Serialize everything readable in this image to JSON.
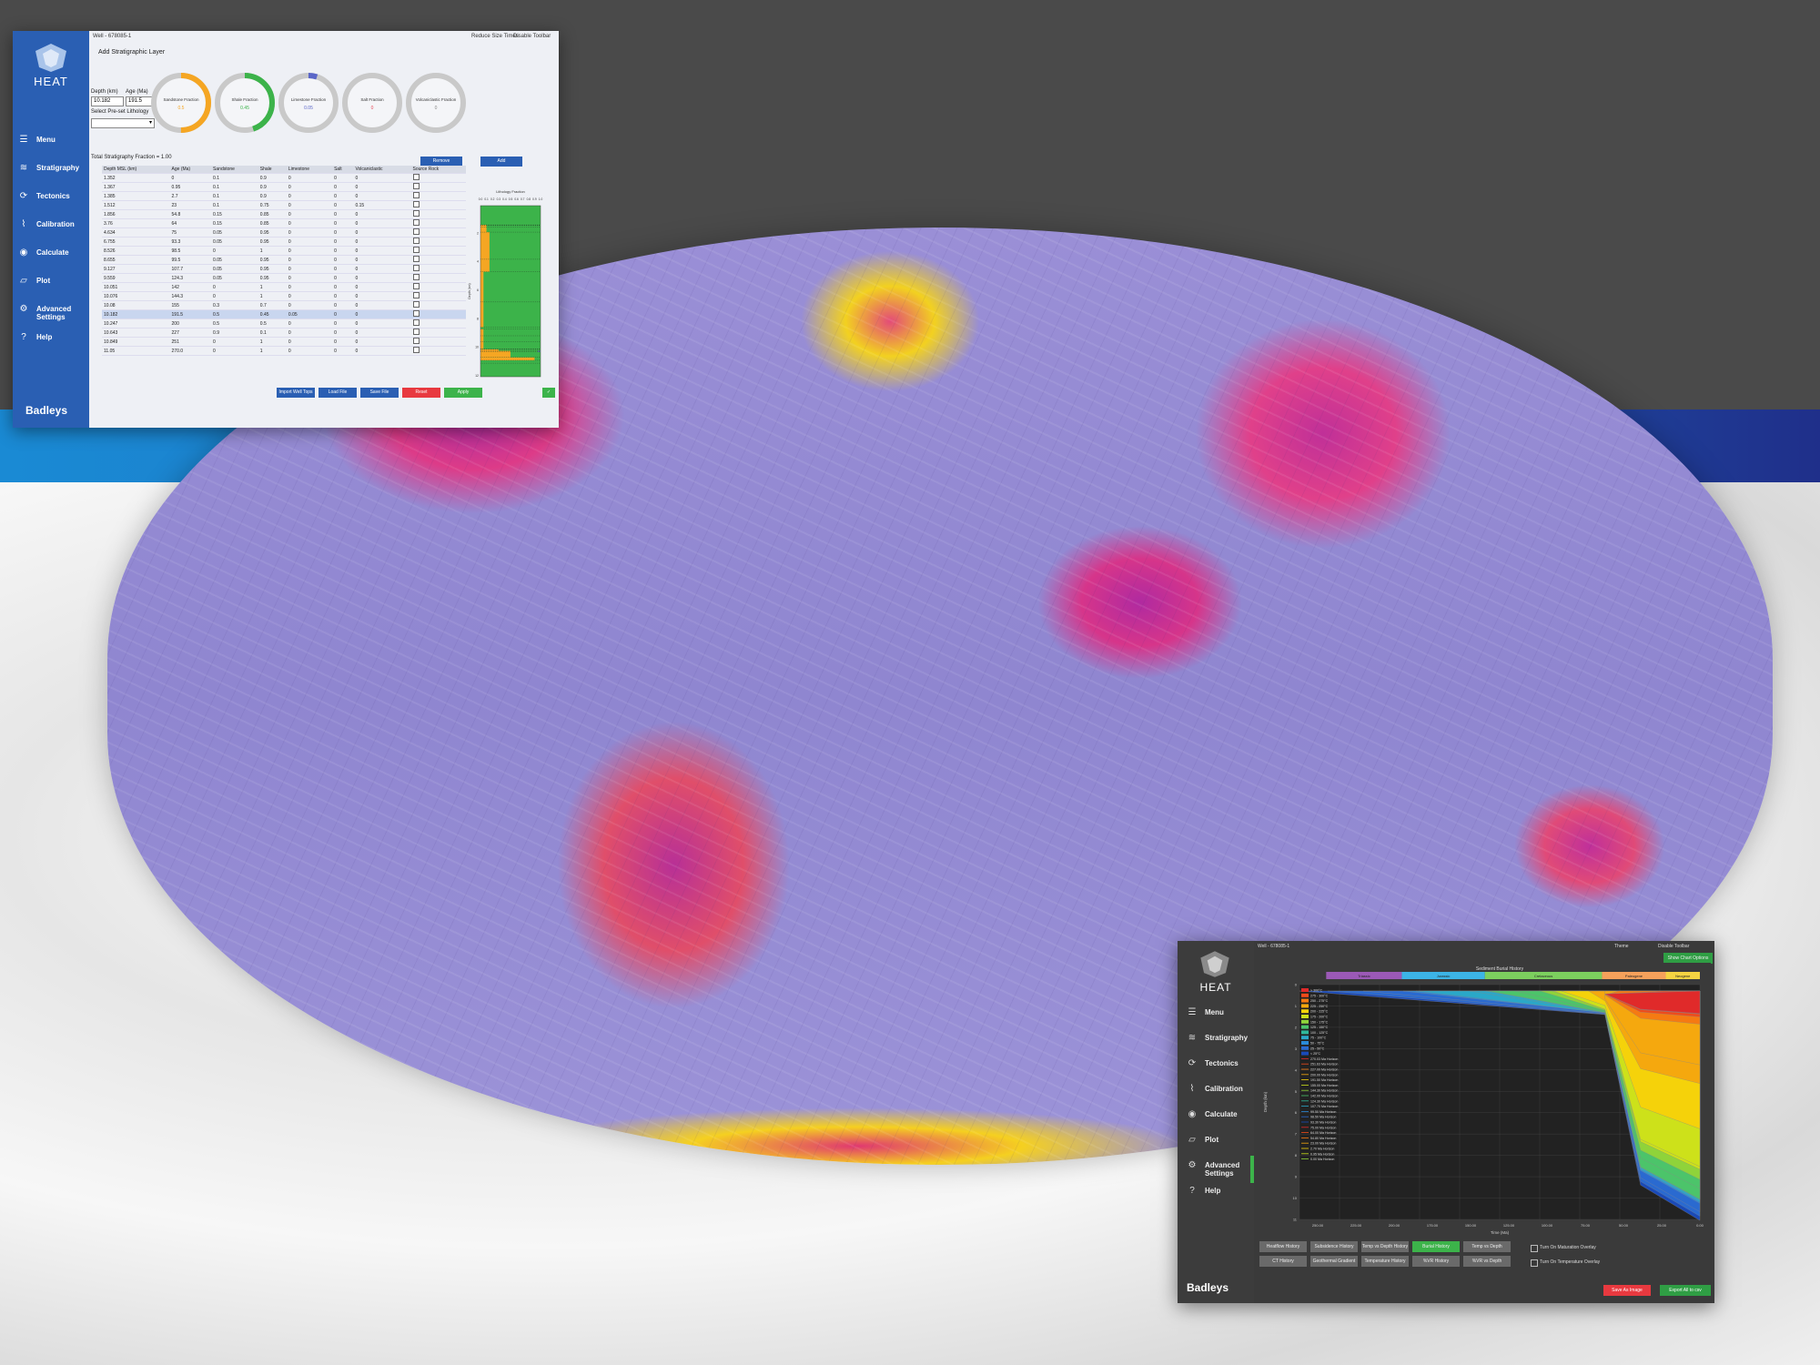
{
  "windowA": {
    "title": "Well - 678085-1",
    "header_right": [
      "Reduce Size Times",
      "Disable Toolbar"
    ],
    "brand": "HEAT",
    "nav": [
      {
        "label": "Menu",
        "icon": "hamburger-icon"
      },
      {
        "label": "Stratigraphy",
        "icon": "strata-icon"
      },
      {
        "label": "Tectonics",
        "icon": "tectonics-icon"
      },
      {
        "label": "Calibration",
        "icon": "calibration-icon"
      },
      {
        "label": "Calculate",
        "icon": "droplet-icon"
      },
      {
        "label": "Plot",
        "icon": "plot-icon"
      },
      {
        "label": "Advanced Settings",
        "icon": "gears-icon"
      },
      {
        "label": "Help",
        "icon": "help-icon"
      }
    ],
    "footer": "Badleys",
    "section_title": "Add Stratigraphic Layer",
    "depth_label": "Depth (km)",
    "depth_value": "10.182",
    "age_label": "Age (Ma)",
    "age_value": "191.5",
    "preset_label": "Select Pre-set Lithology",
    "total_fraction": "Total Stratigraphy Fraction = 1.00",
    "fractions": [
      {
        "label": "Sandstone Fraction",
        "value": "0.5",
        "fraction": 0.5,
        "color": "#f5a623"
      },
      {
        "label": "Shale Fraction",
        "value": "0.45",
        "fraction": 0.45,
        "color": "#3cb34a"
      },
      {
        "label": "Limestone Fraction",
        "value": "0.05",
        "fraction": 0.05,
        "color": "#5a66c8"
      },
      {
        "label": "Salt Fraction",
        "value": "0",
        "fraction": 0,
        "color": "#e84b5a"
      },
      {
        "label": "Volcaniclastic Fraction",
        "value": "0",
        "fraction": 0,
        "color": "#888888"
      }
    ],
    "table": {
      "columns": [
        "Depth MSL (km)",
        "Age (Ma)",
        "Sandstone",
        "Shale",
        "Limestone",
        "Salt",
        "Volcaniclastic",
        "Source Rock"
      ],
      "rows": [
        [
          "1.352",
          "0",
          "0.1",
          "0.9",
          "0",
          "0",
          "0"
        ],
        [
          "1.367",
          "0.95",
          "0.1",
          "0.9",
          "0",
          "0",
          "0"
        ],
        [
          "1.385",
          "2.7",
          "0.1",
          "0.9",
          "0",
          "0",
          "0"
        ],
        [
          "1.512",
          "23",
          "0.1",
          "0.75",
          "0",
          "0",
          "0.15"
        ],
        [
          "1.856",
          "54.8",
          "0.15",
          "0.85",
          "0",
          "0",
          "0"
        ],
        [
          "3.76",
          "64",
          "0.15",
          "0.85",
          "0",
          "0",
          "0"
        ],
        [
          "4.634",
          "75",
          "0.05",
          "0.95",
          "0",
          "0",
          "0"
        ],
        [
          "6.755",
          "93.3",
          "0.05",
          "0.95",
          "0",
          "0",
          "0"
        ],
        [
          "8.526",
          "98.5",
          "0",
          "1",
          "0",
          "0",
          "0"
        ],
        [
          "8.655",
          "99.5",
          "0.05",
          "0.95",
          "0",
          "0",
          "0"
        ],
        [
          "9.127",
          "107.7",
          "0.05",
          "0.95",
          "0",
          "0",
          "0"
        ],
        [
          "9.559",
          "124.3",
          "0.05",
          "0.95",
          "0",
          "0",
          "0"
        ],
        [
          "10.051",
          "142",
          "0",
          "1",
          "0",
          "0",
          "0"
        ],
        [
          "10.076",
          "144.3",
          "0",
          "1",
          "0",
          "0",
          "0"
        ],
        [
          "10.08",
          "155",
          "0.3",
          "0.7",
          "0",
          "0",
          "0"
        ],
        [
          "10.182",
          "191.5",
          "0.5",
          "0.45",
          "0.05",
          "0",
          "0"
        ],
        [
          "10.247",
          "200",
          "0.5",
          "0.5",
          "0",
          "0",
          "0"
        ],
        [
          "10.643",
          "227",
          "0.9",
          "0.1",
          "0",
          "0",
          "0"
        ],
        [
          "10.849",
          "251",
          "0",
          "1",
          "0",
          "0",
          "0"
        ],
        [
          "11.05",
          "270.0",
          "0",
          "1",
          "0",
          "0",
          "0"
        ]
      ],
      "selected_index": 15
    },
    "litho_title": "Lithology Fraction",
    "litho_ticks": [
      "0.0",
      "0.1",
      "0.2",
      "0.3",
      "0.4",
      "0.5",
      "0.6",
      "0.7",
      "0.8",
      "0.9",
      "1.0"
    ],
    "depth_axis_ticks": [
      "2",
      "4",
      "6",
      "8",
      "10",
      "12"
    ],
    "depth_axis_label": "Depth (km)",
    "buttons": [
      "Import Well Tops",
      "Load File",
      "Save File",
      "Reset",
      "Apply"
    ],
    "remove_label": "Remove",
    "add_label": "Add",
    "colors": {
      "sidebar": "#2a5fb3",
      "reset": "#e8393f",
      "apply": "#3cb34a"
    }
  },
  "windowB": {
    "title": "Well - 678085-1",
    "header_right": [
      "Theme",
      "Disable Toolbar"
    ],
    "brand": "HEAT",
    "nav": [
      {
        "label": "Menu",
        "icon": "hamburger-icon"
      },
      {
        "label": "Stratigraphy",
        "icon": "strata-icon"
      },
      {
        "label": "Tectonics",
        "icon": "tectonics-icon"
      },
      {
        "label": "Calibration",
        "icon": "calibration-icon"
      },
      {
        "label": "Calculate",
        "icon": "droplet-icon"
      },
      {
        "label": "Plot",
        "icon": "plot-icon"
      },
      {
        "label": "Advanced Settings",
        "icon": "gears-icon"
      },
      {
        "label": "Help",
        "icon": "help-icon"
      }
    ],
    "footer": "Badleys",
    "show_chart_options": "Show Chart Options",
    "chart_title": "Sediment Burial History",
    "periods": [
      {
        "name": "Triassic",
        "color": "#9b59b6"
      },
      {
        "name": "Jurassic",
        "color": "#3cb4e6"
      },
      {
        "name": "Cretaceous",
        "color": "#7ccf5e"
      },
      {
        "name": "Paleogene",
        "color": "#f5a15b"
      },
      {
        "name": "Neogene",
        "color": "#f5d442"
      }
    ],
    "legend_temps": [
      "> 300°C",
      "275 - 300°C",
      "250 - 275°C",
      "225 - 250°C",
      "200 - 225°C",
      "175 - 200°C",
      "150 - 175°C",
      "125 - 150°C",
      "100 - 125°C",
      "75 - 100°C",
      "50 - 75°C",
      "25 - 50°C",
      "< 25°C"
    ],
    "legend_horizons": [
      "270.03 Ma Horizon",
      "251.63 Ma Horizon",
      "227.00 Ma Horizon",
      "200.00 Ma Horizon",
      "191.50 Ma Horizon",
      "155.00 Ma Horizon",
      "144.30 Ma Horizon",
      "142.00 Ma Horizon",
      "124.30 Ma Horizon",
      "107.70 Ma Horizon",
      "99.50 Ma Horizon",
      "98.50 Ma Horizon",
      "93.30 Ma Horizon",
      "75.00 Ma Horizon",
      "64.00 Ma Horizon",
      "54.80 Ma Horizon",
      "23.00 Ma Horizon",
      "2.70 Ma Horizon",
      "0.95 Ma Horizon",
      "0.00 Ma Horizon"
    ],
    "y_label": "Depth (km)",
    "x_label": "Time (Ma)",
    "x_ticks": [
      "250.00",
      "225.00",
      "200.00",
      "175.00",
      "150.00",
      "125.00",
      "100.00",
      "75.00",
      "50.00",
      "25.00",
      "0.00"
    ],
    "y_ticks": [
      "0",
      "1",
      "2",
      "3",
      "4",
      "5",
      "6",
      "7",
      "8",
      "9",
      "10",
      "11"
    ],
    "buttons_row1": [
      "Heatflow History",
      "Subsidence History",
      "Temp vs Depth History",
      "Burial History",
      "Temp vs Depth"
    ],
    "buttons_row2": [
      "CT History",
      "Geothermal Gradient",
      "Temperature History",
      "%VR History",
      "%VR vs Depth"
    ],
    "active_button": "Burial History",
    "toggle1": "Turn On Maturation Overlay",
    "toggle2": "Turn On Temperature Overlay",
    "save_image": "Save As Image",
    "export": "Export All to csv",
    "colors": {
      "save": "#e8393f",
      "export": "#2f9e44",
      "active": "#3cb34a"
    }
  }
}
